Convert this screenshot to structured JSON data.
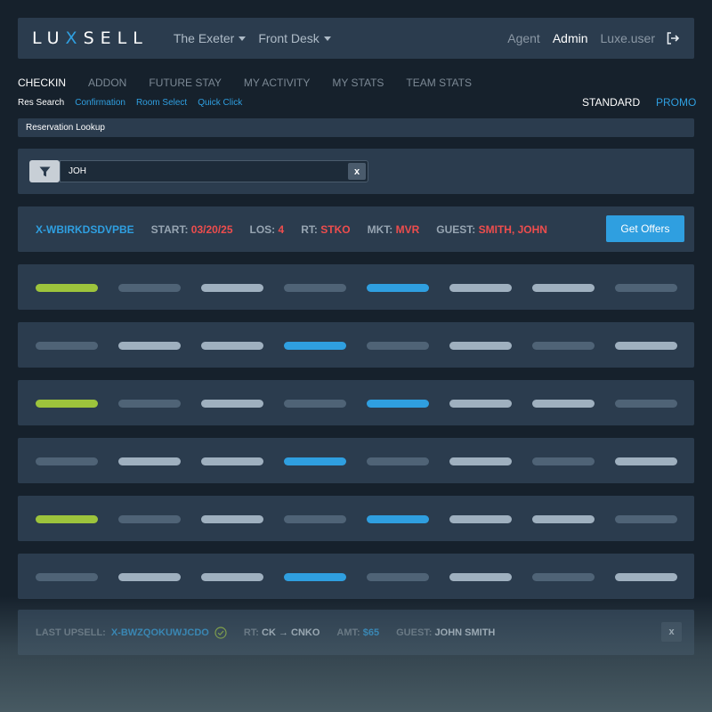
{
  "header": {
    "logo_pre": "LU",
    "logo_x": "X",
    "logo_post": "SELL",
    "property": "The Exeter",
    "department": "Front Desk",
    "role_agent": "Agent",
    "role_admin": "Admin",
    "username": "Luxe.user",
    "logout_icon": "logout-icon"
  },
  "nav": {
    "tabs": [
      "CHECKIN",
      "ADDON",
      "FUTURE STAY",
      "MY ACTIVITY",
      "MY STATS",
      "TEAM STATS"
    ],
    "active_tab": "CHECKIN",
    "subtabs": [
      "Res Search",
      "Confirmation",
      "Room Select",
      "Quick Click"
    ],
    "active_subtab": "Res Search",
    "mode_standard": "STANDARD",
    "mode_promo": "PROMO"
  },
  "section_title": "Reservation Lookup",
  "search": {
    "value": "JOH",
    "clear_label": "x",
    "filter_icon": "filter-icon"
  },
  "reservation": {
    "confirmation": "X-WBIRKDSDVPBE",
    "start_label": "START:",
    "start_value": "03/20/25",
    "los_label": "LOS:",
    "los_value": "4",
    "rt_label": "RT:",
    "rt_value": "STKO",
    "mkt_label": "MKT:",
    "mkt_value": "MVR",
    "guest_label": "GUEST:",
    "guest_value": "SMITH, JOHN",
    "offers_button": "Get Offers"
  },
  "placeholder_rows": [
    [
      "green",
      "dark",
      "light",
      "dark",
      "blue",
      "light",
      "light",
      "dark"
    ],
    [
      "dark",
      "light",
      "light",
      "blue",
      "dark",
      "light",
      "dark",
      "light"
    ],
    [
      "green",
      "dark",
      "light",
      "dark",
      "blue",
      "light",
      "light",
      "dark"
    ],
    [
      "dark",
      "light",
      "light",
      "blue",
      "dark",
      "light",
      "dark",
      "light"
    ],
    [
      "green",
      "dark",
      "light",
      "dark",
      "blue",
      "light",
      "light",
      "dark"
    ],
    [
      "dark",
      "light",
      "light",
      "blue",
      "dark",
      "light",
      "dark",
      "light"
    ]
  ],
  "colors": {
    "green": "#9dc43c",
    "blue": "#2f9fe0",
    "light": "#9fb0bf",
    "dark": "#4f6376",
    "accent": "#2f9fe0",
    "alert": "#ee4d4d"
  },
  "last_upsell": {
    "label": "LAST UPSELL:",
    "confirmation": "X-BWZQOKUWJCDO",
    "rt_label": "RT:",
    "rt_value": "CK → CNKO",
    "amt_label": "AMT:",
    "amt_value": "$65",
    "guest_label": "GUEST:",
    "guest_value": "JOHN SMITH",
    "dismiss_label": "x"
  }
}
